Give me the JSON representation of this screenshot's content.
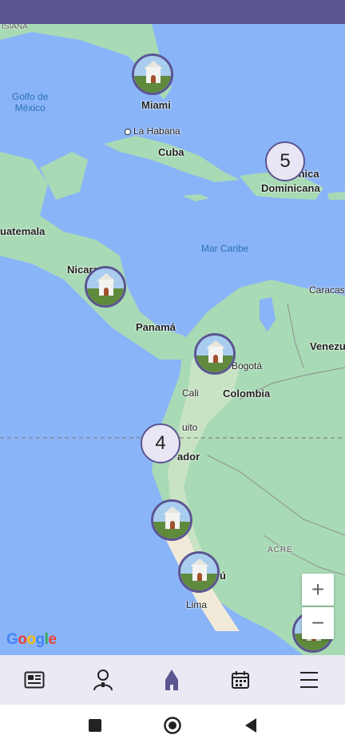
{
  "map": {
    "labels": {
      "louisiana": "ISIANA",
      "golfo": "Golfo de\nMéxico",
      "miami": "Miami",
      "la_habana": "La Habana",
      "cuba": "Cuba",
      "dominicana_top": "inica",
      "dominicana": "Dominicana",
      "guatemala": "uatemala",
      "mar_caribe": "Mar Caribe",
      "nicaragua": "Nicara",
      "panama": "Panamá",
      "caracas": "Caracas",
      "venezuela": "Venezu",
      "bogota": "Bogotá",
      "cali": "Cali",
      "colombia": "Colombia",
      "quito": "uito",
      "ecuador": "ador",
      "acre": "ACRE",
      "peru": "ú",
      "lima": "Lima"
    },
    "clusters": [
      {
        "count": "5"
      },
      {
        "count": "4"
      }
    ],
    "zoom_in": "+",
    "zoom_out": "−",
    "attribution": "Google"
  },
  "nav": {
    "items": [
      {
        "name": "news",
        "icon": "newspaper-icon"
      },
      {
        "name": "priest",
        "icon": "person-icon"
      },
      {
        "name": "church",
        "icon": "church-icon",
        "active": true
      },
      {
        "name": "calendar",
        "icon": "calendar-icon"
      },
      {
        "name": "menu",
        "icon": "menu-icon"
      }
    ]
  },
  "colors": {
    "accent": "#5b5592",
    "water": "#8ab4f8",
    "land": "#a8dab5",
    "nav_bg": "#ece9f5"
  }
}
